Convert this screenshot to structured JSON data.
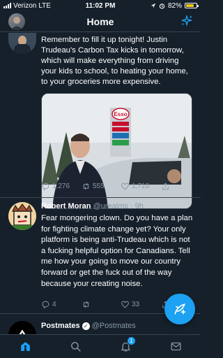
{
  "status_bar": {
    "carrier": "Verizon",
    "network": "LTE",
    "time": "11:02 PM",
    "battery_percent": "82%",
    "battery_level": 0.82
  },
  "header": {
    "title": "Home"
  },
  "tweets": [
    {
      "text": "Remember to fill it up tonight! Justin Trudeau's Carbon Tax kicks in tomorrow, which will make everything from driving your kids to school, to heating your home, to your groceries more expensive.",
      "media": {
        "sign_brand": "Esso",
        "sign_lines": [
          "",
          "",
          ""
        ]
      },
      "actions": {
        "replies": "1,276",
        "retweets": "555",
        "likes": "1,710"
      }
    },
    {
      "name": "Robert Moran",
      "handle": "@urealms",
      "dot": "·",
      "time": "9h",
      "text": "Fear mongering clown. Do you have a plan for fighting climate change yet? Your only platform is being anti-Trudeau which is not a fucking helpful option for Canadians. Tell me how your going to move our country forward or get the fuck out of the way because your creating noise.",
      "actions": {
        "replies": "4",
        "retweets": "",
        "likes": "33"
      }
    },
    {
      "name": "Postmates",
      "handle": "@Postmates"
    }
  ],
  "tabbar": {
    "notifications_badge": "1"
  },
  "colors": {
    "background": "#15202b",
    "accent": "#1da1f2",
    "secondary_text": "#8899a6",
    "divider": "#38444d"
  }
}
